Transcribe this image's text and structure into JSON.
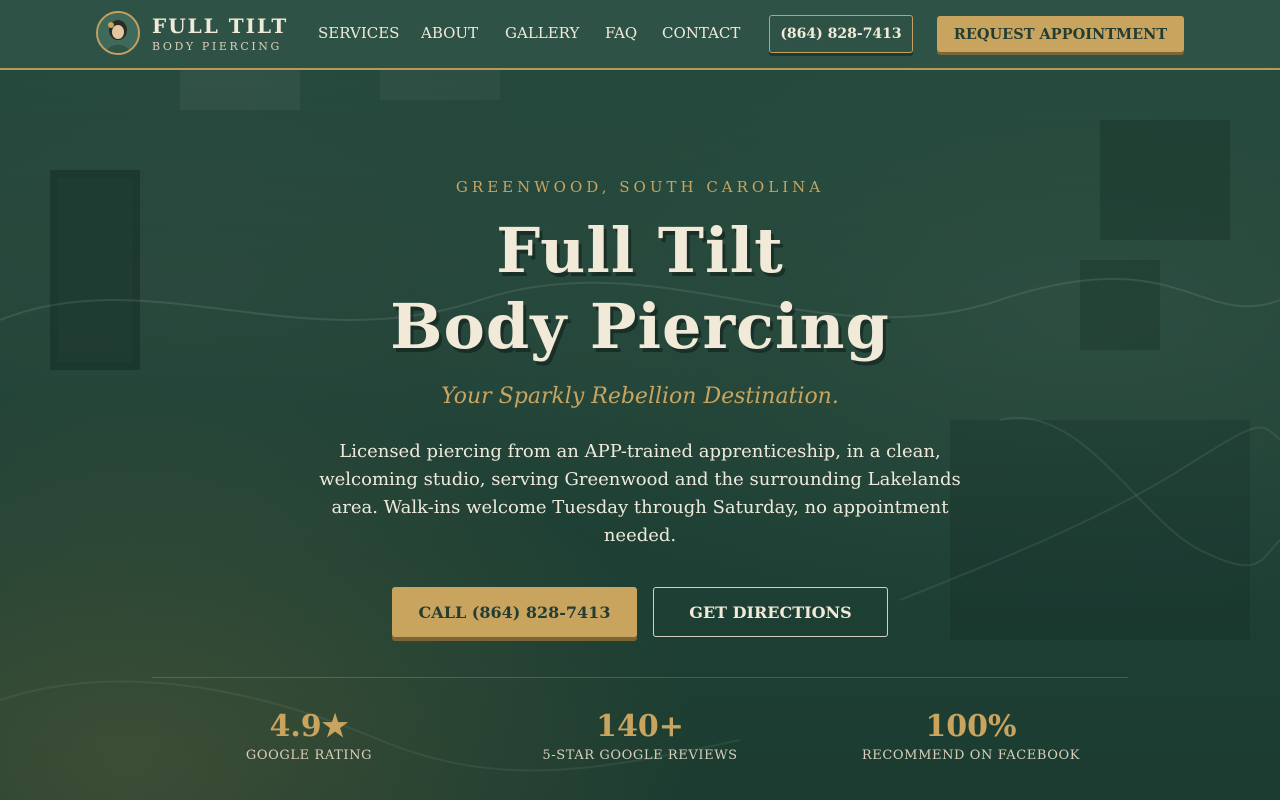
{
  "header": {
    "brand_name": "FULL TILT",
    "brand_sub": "BODY PIERCING",
    "nav": [
      "SERVICES",
      "ABOUT",
      "GALLERY",
      "FAQ",
      "CONTACT"
    ],
    "phone": "(864) 828-7413",
    "cta": "REQUEST APPOINTMENT"
  },
  "hero": {
    "eyebrow": "GREENWOOD, SOUTH CAROLINA",
    "title_line1": "Full Tilt",
    "title_line2": "Body Piercing",
    "tagline": "Your Sparkly Rebellion Destination.",
    "description": "Licensed piercing from an APP-trained apprenticeship, in a clean, welcoming studio, serving Greenwood and the surrounding Lakelands area. Walk-ins welcome Tuesday through Saturday, no appointment needed.",
    "call_button": "CALL (864) 828-7413",
    "directions_button": "GET DIRECTIONS"
  },
  "stats": [
    {
      "value": "4.9★",
      "label": "GOOGLE RATING"
    },
    {
      "value": "140+",
      "label": "5-STAR GOOGLE REVIEWS"
    },
    {
      "value": "100%",
      "label": "RECOMMEND ON FACEBOOK"
    }
  ],
  "colors": {
    "primary_green": "#1f4236",
    "header_green": "#2e5246",
    "accent_gold": "#c9a45f",
    "cream_text": "#f2ead9"
  }
}
